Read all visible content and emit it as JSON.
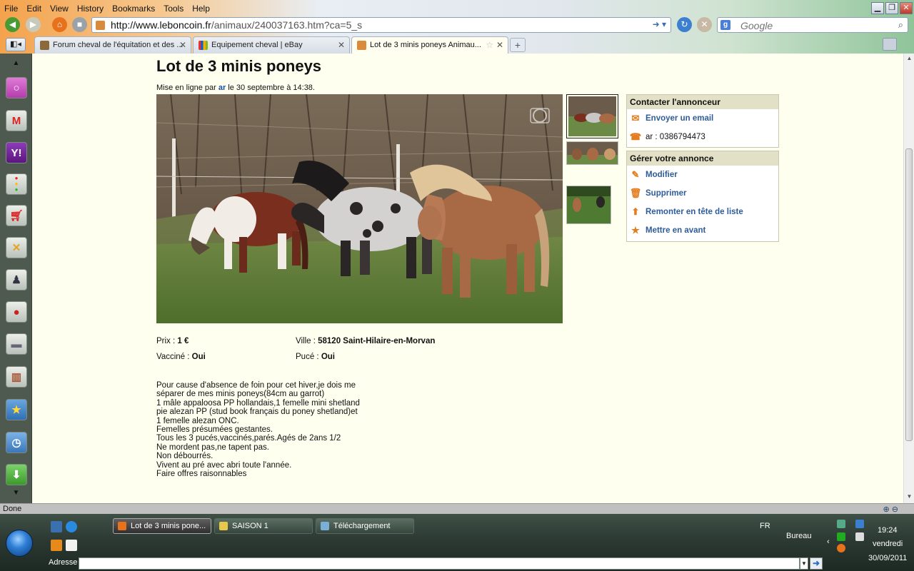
{
  "browser": {
    "menu": [
      "File",
      "Edit",
      "View",
      "History",
      "Bookmarks",
      "Tools",
      "Help"
    ],
    "url_domain": "http://www.leboncoin.fr",
    "url_path": "/animaux/240037163.htm?ca=5_s",
    "search_placeholder": "Google",
    "tabs": [
      {
        "label": "Forum cheval de l'équitation et des ..."
      },
      {
        "label": "Equipement cheval | eBay"
      },
      {
        "label": "Lot de 3 minis poneys Animau..."
      }
    ],
    "status": "Done",
    "colors": {
      "active_tab_bg": "#fffef0",
      "link": "#2e5c9a"
    }
  },
  "ad": {
    "title": "Lot de 3 minis poneys",
    "meta_prefix": "Mise en ligne par ",
    "author": "ar",
    "meta_suffix": " le 30 septembre à 14:38.",
    "price_label": "Prix : ",
    "price": "1 €",
    "city_label": "Ville : ",
    "city": "58120 Saint-Hilaire-en-Morvan",
    "vaccine_label": "Vacciné : ",
    "vaccine": "Oui",
    "chip_label": "Pucé : ",
    "chip": "Oui",
    "description": [
      "Pour cause d'absence de foin pour cet hiver,je dois me",
      "séparer de mes minis poneys(84cm au garrot)",
      "1 mâle appaloosa PP hollandais,1 femelle mini shetland",
      "pie alezan PP (stud book français du poney shetland)et",
      "1 femelle alezan ONC.",
      "Femelles présumées gestantes.",
      "Tous les 3 pucés,vaccinés,parés.Agés de 2ans 1/2",
      "Ne mordent pas,ne tapent pas.",
      "Non débourrés.",
      "Vivent au pré avec abri toute l'année.",
      "Faire offres raisonnables"
    ]
  },
  "contact_panel": {
    "title": "Contacter l'annonceur",
    "email_label": "Envoyer un email",
    "phone_text": "ar : 0386794473"
  },
  "manage_panel": {
    "title": "Gérer votre annonce",
    "items": [
      {
        "label": "Modifier",
        "icon": "pencil-icon"
      },
      {
        "label": "Supprimer",
        "icon": "trash-icon"
      },
      {
        "label": "Remonter en tête de liste",
        "icon": "arrow-up-icon"
      },
      {
        "label": "Mettre en avant",
        "icon": "star-icon"
      }
    ]
  },
  "taskbar": {
    "tasks": [
      {
        "label": "Lot de 3 minis pone..."
      },
      {
        "label": "SAISON 1"
      },
      {
        "label": "Téléchargement"
      }
    ],
    "lang": "FR",
    "desktop": "Bureau",
    "time": "19:24",
    "day": "vendredi",
    "date": "30/09/2011",
    "address_label": "Adresse"
  }
}
